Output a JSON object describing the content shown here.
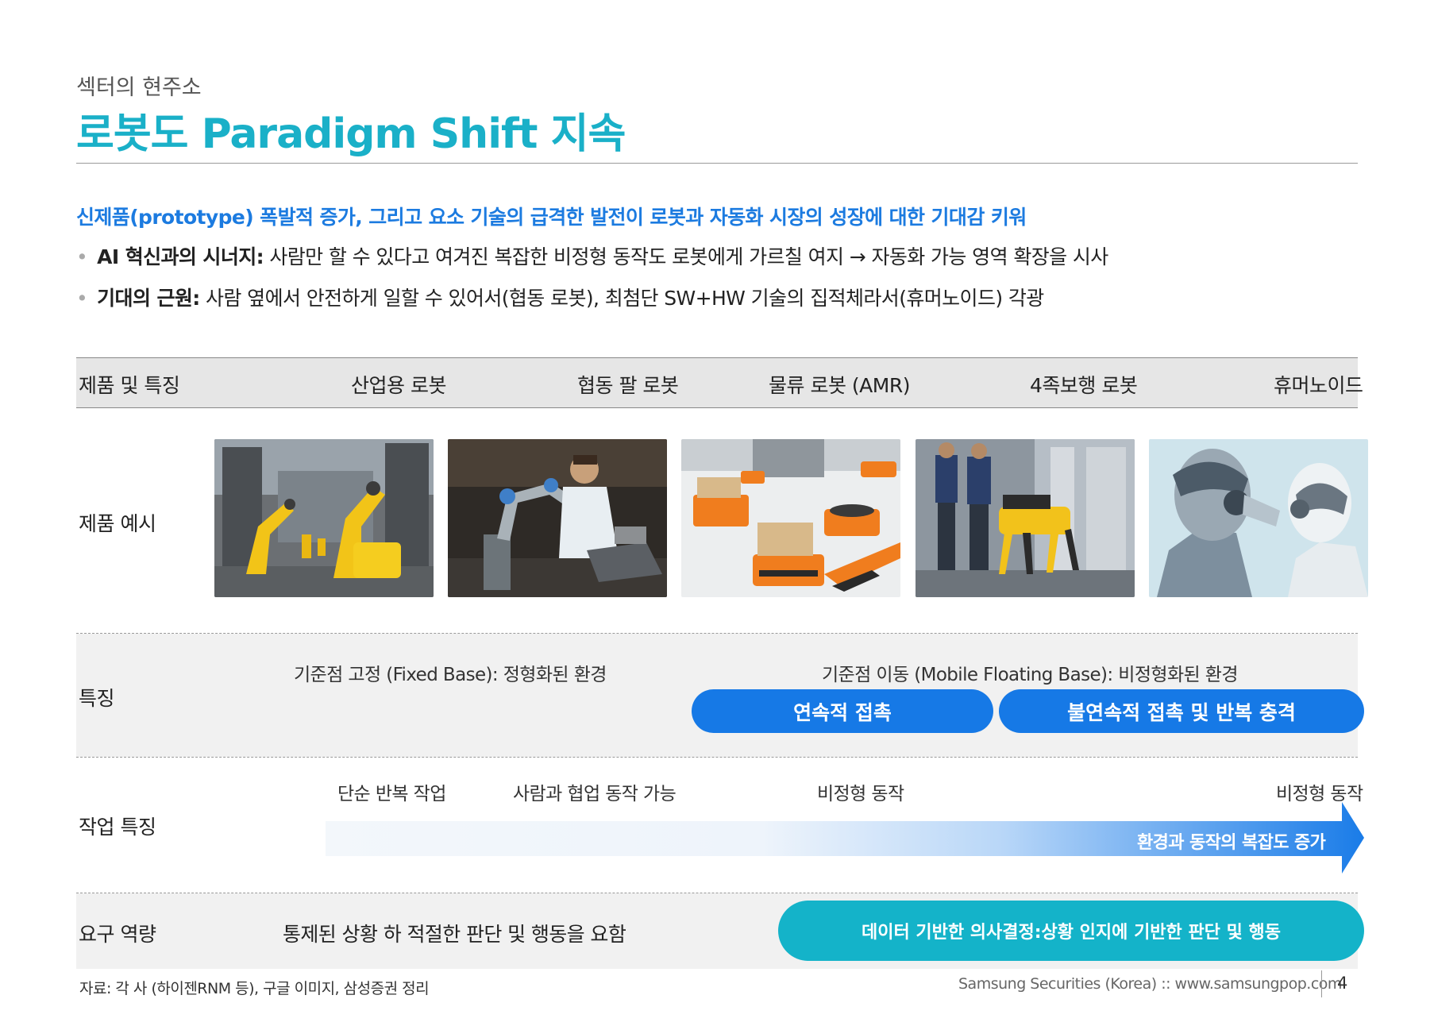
{
  "header": {
    "section": "섹터의 현주소",
    "title": "로봇도 Paradigm Shift 지속"
  },
  "summary": {
    "lead": "신제품(prototype) 폭발적 증가, 그리고 요소 기술의 급격한 발전이 로봇과 자동화 시장의 성장에 대한 기대감 키워",
    "bullets": [
      {
        "bold": "AI 혁신과의 시너지:",
        "text": " 사람만 할 수 있다고 여겨진 복잡한 비정형 동작도 로봇에게 가르칠 여지 → 자동화 가능 영역 확장을 시사"
      },
      {
        "bold": "기대의 근원:",
        "text": " 사람 옆에서 안전하게 일할 수 있어서(협동 로봇), 최첨단 SW+HW 기술의 집적체라서(휴머노이드) 각광"
      }
    ]
  },
  "table": {
    "header_label": "제품 및 특징",
    "columns": [
      "산업용 로봇",
      "협동 팔 로봇",
      "물류 로봇 (AMR)",
      "4족보행 로봇",
      "휴머노이드"
    ],
    "rows": {
      "example_label": "제품 예시",
      "feature_label": "특징",
      "task_label": "작업 특징",
      "capability_label": "요구 역량"
    },
    "features": {
      "fixed": "기준점 고정 (Fixed Base): 정형화된 환경",
      "mobile": "기준점 이동 (Mobile Floating Base): 비정형화된 환경",
      "pill_continuous": "연속적 접촉",
      "pill_discontinuous": "불연속적 접촉 및 반복 충격"
    },
    "tasks": {
      "t1": "단순 반복 작업",
      "t2": "사람과 협업 동작 가능",
      "t3": "비정형 동작",
      "t4": "비정형 동작",
      "arrow_label": "환경과 동작의 복잡도 증가"
    },
    "capabilities": {
      "controlled": "통제된 상황 하 적절한 판단 및 행동을 요함",
      "data_pill": "데이터 기반한 의사결정:상황 인지에 기반한 판단 및 행동"
    }
  },
  "footer": {
    "source": "자료: 각 사 (하이젠RNM 등), 구글 이미지, 삼성증권 정리",
    "company": "Samsung Securities (Korea) :: www.samsungpop.com",
    "page": "4"
  },
  "colors": {
    "title": "#1ab0c8",
    "lead": "#1c7be0",
    "pill_blue": "#1679e6",
    "pill_cyan": "#14b3c9"
  },
  "icons": [
    "industrial-robot-photo",
    "cobot-photo",
    "amr-photo",
    "quadruped-robot-photo",
    "humanoid-photo"
  ]
}
